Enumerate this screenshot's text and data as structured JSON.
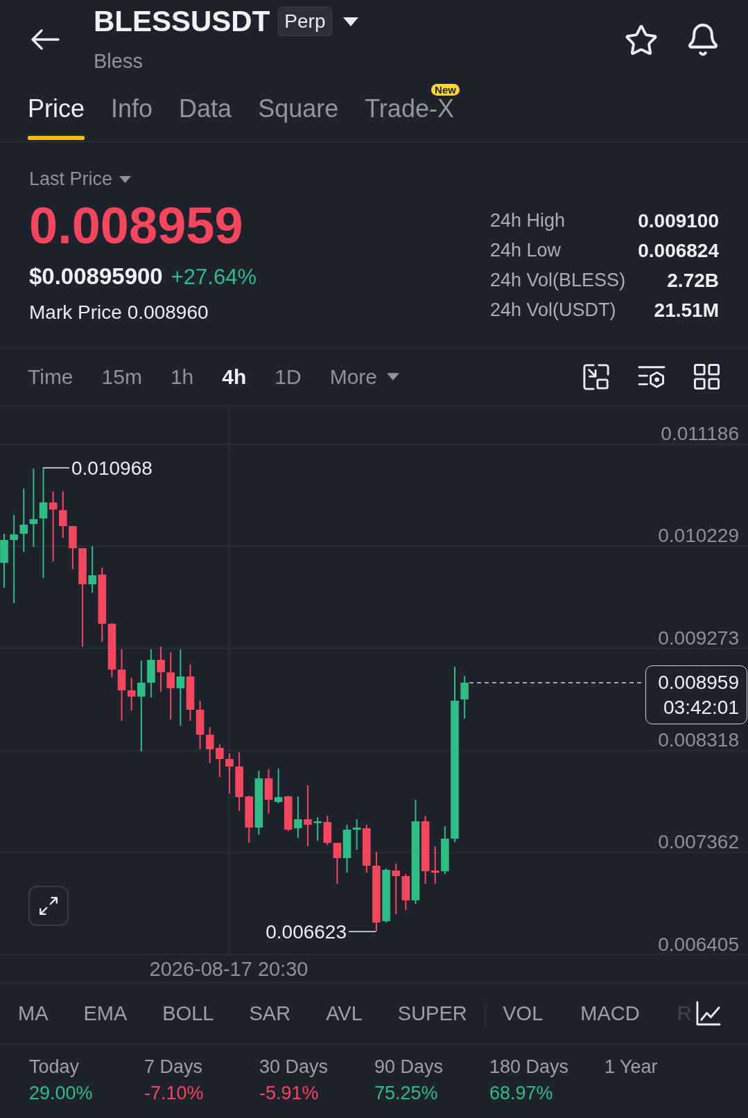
{
  "header": {
    "symbol": "BLESSUSDT",
    "contract_type": "Perp",
    "name": "Bless",
    "favorited": false
  },
  "tabs": [
    {
      "label": "Price",
      "selected": true
    },
    {
      "label": "Info",
      "selected": false
    },
    {
      "label": "Data",
      "selected": false
    },
    {
      "label": "Square",
      "selected": false
    },
    {
      "label": "Trade-X",
      "selected": false,
      "badge": "New"
    }
  ],
  "price_panel": {
    "price_type": "Last Price",
    "last_price": "0.008959",
    "last_price_rising": false,
    "usd_price": "$0.00895900",
    "change": "+27.64%",
    "change_rising": true,
    "mark_price_label": "Mark Price",
    "mark_price": "0.008960",
    "stats": [
      {
        "label": "24h High",
        "value": "0.009100"
      },
      {
        "label": "24h Low",
        "value": "0.006824"
      },
      {
        "label": "24h Vol(BLESS)",
        "value": "2.72B"
      },
      {
        "label": "24h Vol(USDT)",
        "value": "21.51M"
      }
    ]
  },
  "intervals": [
    {
      "label": "Time",
      "kind": "option",
      "selected": false
    },
    {
      "label": "15m",
      "kind": "option",
      "selected": false
    },
    {
      "label": "1h",
      "kind": "option",
      "selected": false
    },
    {
      "label": "4h",
      "kind": "option",
      "selected": true
    },
    {
      "label": "1D",
      "kind": "option",
      "selected": false
    },
    {
      "label": "More",
      "kind": "menu",
      "selected": false
    }
  ],
  "chart": {
    "price_axis": [
      "0.011186",
      "0.010229",
      "0.009273",
      "0.008318",
      "0.007362",
      "0.006405"
    ],
    "high_marker": "0.010968",
    "low_marker": "0.006623",
    "current_price": "0.008959",
    "countdown": "03:42:01",
    "time_axis": [
      "2026-08-17 20:30"
    ]
  },
  "indicator_groups": [
    [
      "MA",
      "EMA",
      "BOLL",
      "SAR",
      "AVL",
      "SUPER"
    ],
    [
      "VOL",
      "MACD",
      "R"
    ]
  ],
  "performance": [
    {
      "period": "Today",
      "value": "29.00%",
      "positive": true
    },
    {
      "period": "7 Days",
      "value": "-7.10%",
      "positive": false
    },
    {
      "period": "30 Days",
      "value": "-5.91%",
      "positive": false
    },
    {
      "period": "90 Days",
      "value": "75.25%",
      "positive": true
    },
    {
      "period": "180 Days",
      "value": "68.97%",
      "positive": true
    },
    {
      "period": "1 Year"
    }
  ]
}
